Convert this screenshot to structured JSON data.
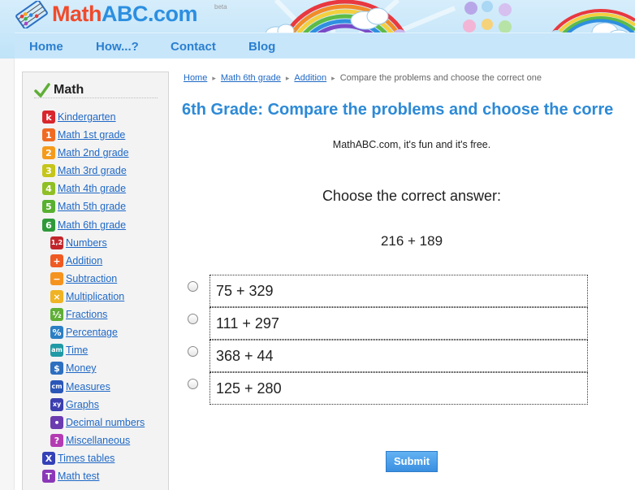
{
  "header": {
    "logo_part1": "Math",
    "logo_part2": "ABC.com",
    "beta": "beta"
  },
  "nav": {
    "items": [
      {
        "label": "Home"
      },
      {
        "label": "How...?"
      },
      {
        "label": "Contact"
      },
      {
        "label": "Blog"
      }
    ]
  },
  "sidebar": {
    "title": "Math",
    "items": [
      {
        "label": "Kindergarten",
        "icon": "k",
        "color": "#d8262c"
      },
      {
        "label": "Math 1st grade",
        "icon": "1",
        "color": "#f06a22"
      },
      {
        "label": "Math 2nd grade",
        "icon": "2",
        "color": "#f59b1c"
      },
      {
        "label": "Math 3rd grade",
        "icon": "3",
        "color": "#c5c51a"
      },
      {
        "label": "Math 4th grade",
        "icon": "4",
        "color": "#8fbf24"
      },
      {
        "label": "Math 5th grade",
        "icon": "5",
        "color": "#58b030"
      },
      {
        "label": "Math 6th grade",
        "icon": "6",
        "color": "#2f9a3a"
      }
    ],
    "subitems": [
      {
        "label": "Numbers",
        "icon": "1,2",
        "color": "#c2262b"
      },
      {
        "label": "Addition",
        "icon": "+",
        "color": "#ef5a23"
      },
      {
        "label": "Subtraction",
        "icon": "−",
        "color": "#f5931f"
      },
      {
        "label": "Multiplication",
        "icon": "×",
        "color": "#f0b323"
      },
      {
        "label": "Fractions",
        "icon": "½",
        "color": "#5fae36"
      },
      {
        "label": "Percentage",
        "icon": "%",
        "color": "#2b7fc4"
      },
      {
        "label": "Time",
        "icon": "am",
        "color": "#1f9aa6"
      },
      {
        "label": "Money",
        "icon": "$",
        "color": "#2d6fc0"
      },
      {
        "label": "Measures",
        "icon": "cm",
        "color": "#2a56b8"
      },
      {
        "label": "Graphs",
        "icon": "xy",
        "color": "#3b3fb0"
      },
      {
        "label": "Decimal numbers",
        "icon": "•",
        "color": "#6b3bb0"
      },
      {
        "label": "Miscellaneous",
        "icon": "?",
        "color": "#b43cb3"
      }
    ],
    "bottom_items": [
      {
        "label": "Times tables",
        "icon": "X",
        "color": "#3340b7"
      },
      {
        "label": "Math test",
        "icon": "T",
        "color": "#8a38b8"
      }
    ]
  },
  "breadcrumb": {
    "items": [
      "Home",
      "Math 6th grade",
      "Addition"
    ],
    "current": "Compare the problems and choose the correct one"
  },
  "main": {
    "title": "6th Grade: Compare the problems and choose the corre",
    "tagline": "MathABC.com, it's fun and it's free.",
    "question_label": "Choose the correct answer:",
    "problem": "216 + 189",
    "options": [
      {
        "label": "75 + 329"
      },
      {
        "label": "111 + 297"
      },
      {
        "label": "368 + 44"
      },
      {
        "label": "125 + 280"
      }
    ],
    "submit_label": "Submit"
  }
}
